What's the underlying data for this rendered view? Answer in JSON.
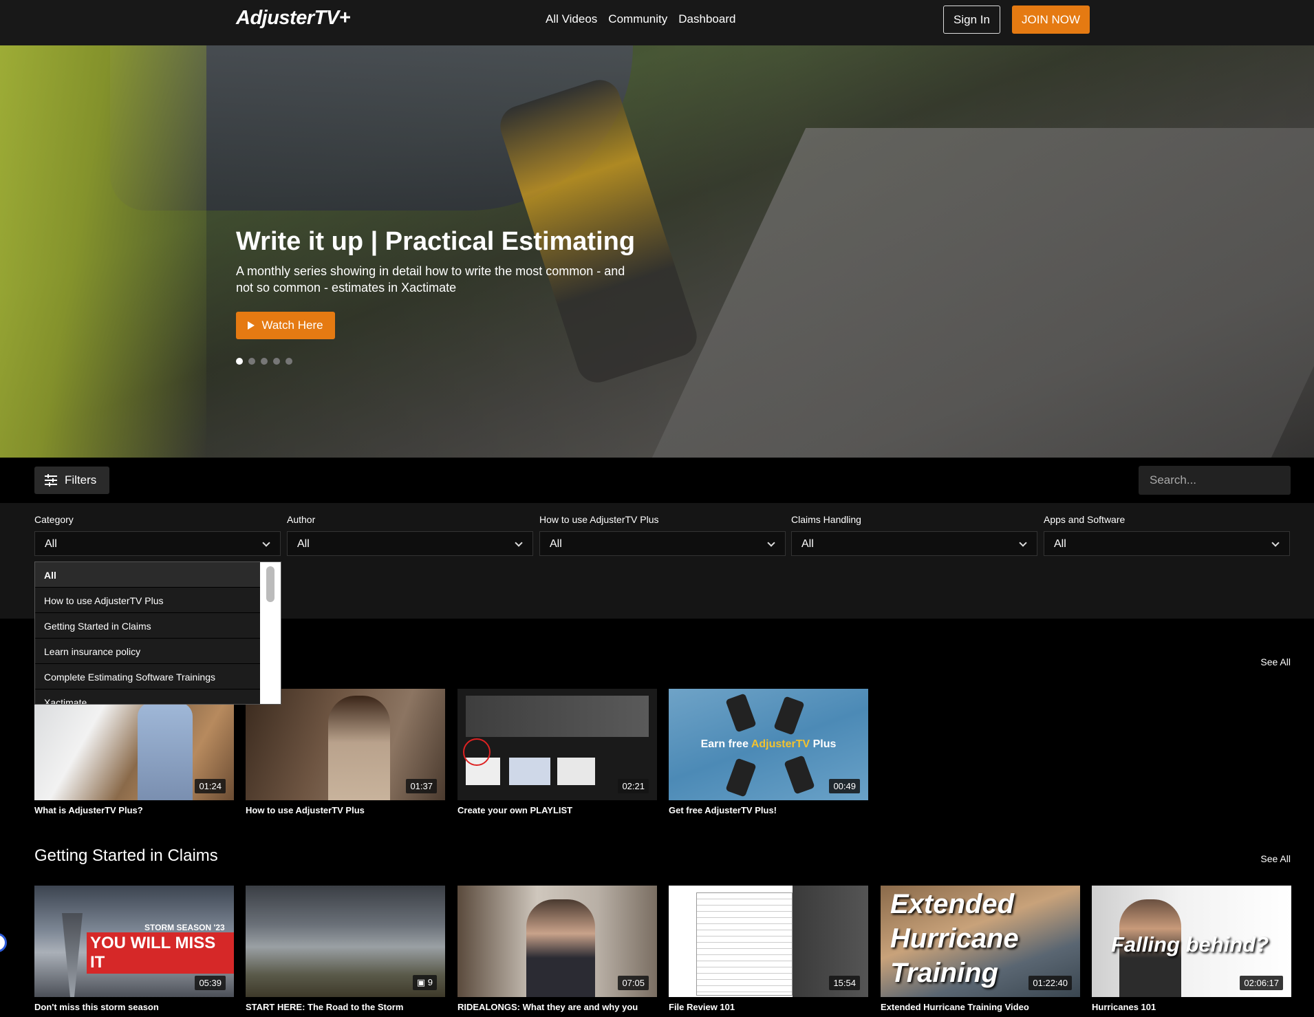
{
  "nav": {
    "logo": "AdjusterTV+",
    "links": [
      "All Videos",
      "Community",
      "Dashboard"
    ],
    "sign_in": "Sign In",
    "join": "JOIN NOW"
  },
  "hero": {
    "title": "Write it up | Practical Estimating",
    "subtitle": "A monthly series showing in detail how to write the most common - and not so common - estimates in Xactimate",
    "watch_label": "Watch Here",
    "slides_total": 5,
    "active_slide": 1
  },
  "filterbar": {
    "filters_label": "Filters",
    "search_placeholder": "Search..."
  },
  "filters": [
    {
      "label": "Category",
      "value": "All"
    },
    {
      "label": "Author",
      "value": "All"
    },
    {
      "label": "How to use AdjusterTV Plus",
      "value": "All"
    },
    {
      "label": "Claims Handling",
      "value": "All"
    },
    {
      "label": "Apps and Software",
      "value": "All"
    }
  ],
  "category_dropdown": {
    "options": [
      "All",
      "How to use AdjusterTV Plus",
      "Getting Started in Claims",
      "Learn insurance policy",
      "Complete Estimating Software Trainings",
      "Xactimate"
    ]
  },
  "section1": {
    "see_all": "See All",
    "cards": [
      {
        "title": "What is AdjusterTV Plus?",
        "duration": "01:24"
      },
      {
        "title": "How to use AdjusterTV Plus",
        "duration": "01:37"
      },
      {
        "title": "Create your own PLAYLIST",
        "duration": "02:21"
      },
      {
        "title": "Get free AdjusterTV Plus!",
        "duration": "00:49",
        "thumb_text_a": "Earn free ",
        "thumb_text_b": "AdjusterTV",
        "thumb_text_c": " Plus"
      }
    ]
  },
  "section2": {
    "title": "Getting Started in Claims",
    "see_all": "See All",
    "cards": [
      {
        "title": "Don't miss this storm season",
        "duration": "05:39",
        "thumb_text_a": "STORM SEASON '23",
        "thumb_text_b": "YOU WILL MISS IT"
      },
      {
        "title": "START HERE: The Road to the Storm",
        "duration": "9"
      },
      {
        "title": "RIDEALONGS: What they are and why you",
        "duration": "07:05"
      },
      {
        "title": "File Review 101",
        "duration": "15:54"
      },
      {
        "title": "Extended Hurricane Training Video",
        "duration": "01:22:40",
        "thumb_text": "Extended Hurricane Training"
      },
      {
        "title": "Hurricanes 101",
        "duration": "02:06:17",
        "thumb_text": "Falling behind?"
      }
    ]
  },
  "colors": {
    "accent": "#e57a12",
    "nav_bg": "#181818",
    "panel_bg": "#151515"
  }
}
